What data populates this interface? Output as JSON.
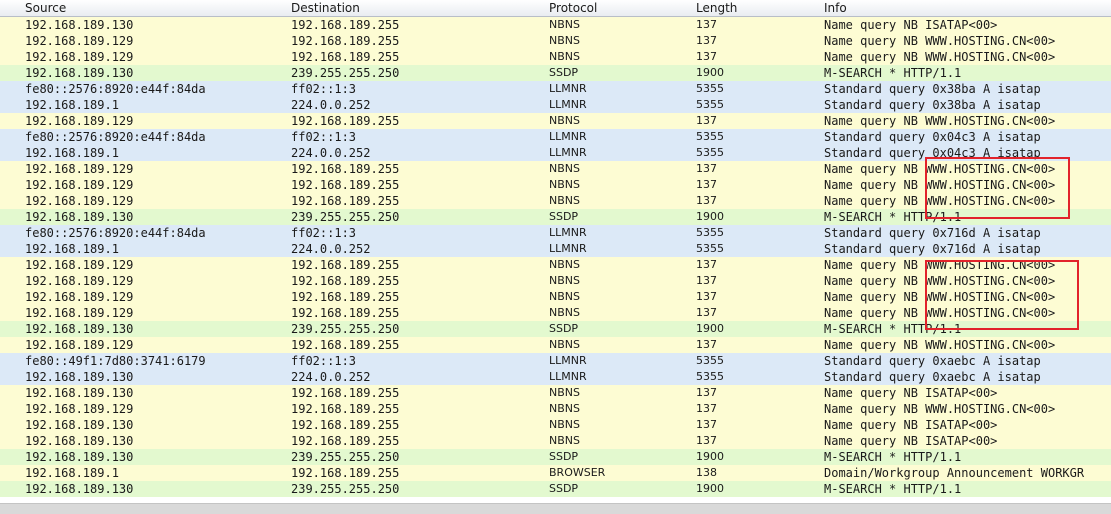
{
  "columns": {
    "source": "Source",
    "destination": "Destination",
    "protocol": "Protocol",
    "length": "Length",
    "info": "Info"
  },
  "colors": {
    "NBNS": "#fdfcd3",
    "SSDP": "#e3f9cf",
    "LLMNR": "#dce9f7",
    "BROWSER": "#fdfcd3",
    "highlight_box": "#e2232b"
  },
  "packets": [
    {
      "source": "192.168.189.130",
      "destination": "192.168.189.255",
      "protocol": "NBNS",
      "length": "137",
      "info": "Name query NB ISATAP<00>"
    },
    {
      "source": "192.168.189.129",
      "destination": "192.168.189.255",
      "protocol": "NBNS",
      "length": "137",
      "info": "Name query NB WWW.HOSTING.CN<00>"
    },
    {
      "source": "192.168.189.129",
      "destination": "192.168.189.255",
      "protocol": "NBNS",
      "length": "137",
      "info": "Name query NB WWW.HOSTING.CN<00>"
    },
    {
      "source": "192.168.189.130",
      "destination": "239.255.255.250",
      "protocol": "SSDP",
      "length": "1900",
      "info": "M-SEARCH * HTTP/1.1"
    },
    {
      "source": "fe80::2576:8920:e44f:84da",
      "destination": "ff02::1:3",
      "protocol": "LLMNR",
      "length": "5355",
      "info": "Standard query 0x38ba  A isatap"
    },
    {
      "source": "192.168.189.1",
      "destination": "224.0.0.252",
      "protocol": "LLMNR",
      "length": "5355",
      "info": "Standard query 0x38ba  A isatap"
    },
    {
      "source": "192.168.189.129",
      "destination": "192.168.189.255",
      "protocol": "NBNS",
      "length": "137",
      "info": "Name query NB WWW.HOSTING.CN<00>"
    },
    {
      "source": "fe80::2576:8920:e44f:84da",
      "destination": "ff02::1:3",
      "protocol": "LLMNR",
      "length": "5355",
      "info": "Standard query 0x04c3  A isatap"
    },
    {
      "source": "192.168.189.1",
      "destination": "224.0.0.252",
      "protocol": "LLMNR",
      "length": "5355",
      "info": "Standard query 0x04c3  A isatap"
    },
    {
      "source": "192.168.189.129",
      "destination": "192.168.189.255",
      "protocol": "NBNS",
      "length": "137",
      "info": "Name query NB WWW.HOSTING.CN<00>"
    },
    {
      "source": "192.168.189.129",
      "destination": "192.168.189.255",
      "protocol": "NBNS",
      "length": "137",
      "info": "Name query NB WWW.HOSTING.CN<00>"
    },
    {
      "source": "192.168.189.129",
      "destination": "192.168.189.255",
      "protocol": "NBNS",
      "length": "137",
      "info": "Name query NB WWW.HOSTING.CN<00>"
    },
    {
      "source": "192.168.189.130",
      "destination": "239.255.255.250",
      "protocol": "SSDP",
      "length": "1900",
      "info": "M-SEARCH * HTTP/1.1"
    },
    {
      "source": "fe80::2576:8920:e44f:84da",
      "destination": "ff02::1:3",
      "protocol": "LLMNR",
      "length": "5355",
      "info": "Standard query 0x716d  A isatap"
    },
    {
      "source": "192.168.189.1",
      "destination": "224.0.0.252",
      "protocol": "LLMNR",
      "length": "5355",
      "info": "Standard query 0x716d  A isatap"
    },
    {
      "source": "192.168.189.129",
      "destination": "192.168.189.255",
      "protocol": "NBNS",
      "length": "137",
      "info": "Name query NB WWW.HOSTING.CN<00>"
    },
    {
      "source": "192.168.189.129",
      "destination": "192.168.189.255",
      "protocol": "NBNS",
      "length": "137",
      "info": "Name query NB WWW.HOSTING.CN<00>"
    },
    {
      "source": "192.168.189.129",
      "destination": "192.168.189.255",
      "protocol": "NBNS",
      "length": "137",
      "info": "Name query NB WWW.HOSTING.CN<00>"
    },
    {
      "source": "192.168.189.129",
      "destination": "192.168.189.255",
      "protocol": "NBNS",
      "length": "137",
      "info": "Name query NB WWW.HOSTING.CN<00>"
    },
    {
      "source": "192.168.189.130",
      "destination": "239.255.255.250",
      "protocol": "SSDP",
      "length": "1900",
      "info": "M-SEARCH * HTTP/1.1"
    },
    {
      "source": "192.168.189.129",
      "destination": "192.168.189.255",
      "protocol": "NBNS",
      "length": "137",
      "info": "Name query NB WWW.HOSTING.CN<00>"
    },
    {
      "source": "fe80::49f1:7d80:3741:6179",
      "destination": "ff02::1:3",
      "protocol": "LLMNR",
      "length": "5355",
      "info": "Standard query 0xaebc  A isatap"
    },
    {
      "source": "192.168.189.130",
      "destination": "224.0.0.252",
      "protocol": "LLMNR",
      "length": "5355",
      "info": "Standard query 0xaebc  A isatap"
    },
    {
      "source": "192.168.189.130",
      "destination": "192.168.189.255",
      "protocol": "NBNS",
      "length": "137",
      "info": "Name query NB ISATAP<00>"
    },
    {
      "source": "192.168.189.129",
      "destination": "192.168.189.255",
      "protocol": "NBNS",
      "length": "137",
      "info": "Name query NB WWW.HOSTING.CN<00>"
    },
    {
      "source": "192.168.189.130",
      "destination": "192.168.189.255",
      "protocol": "NBNS",
      "length": "137",
      "info": "Name query NB ISATAP<00>"
    },
    {
      "source": "192.168.189.130",
      "destination": "192.168.189.255",
      "protocol": "NBNS",
      "length": "137",
      "info": "Name query NB ISATAP<00>"
    },
    {
      "source": "192.168.189.130",
      "destination": "239.255.255.250",
      "protocol": "SSDP",
      "length": "1900",
      "info": "M-SEARCH * HTTP/1.1"
    },
    {
      "source": "192.168.189.1",
      "destination": "192.168.189.255",
      "protocol": "BROWSER",
      "length": "138",
      "info": "Domain/Workgroup Announcement WORKGR"
    },
    {
      "source": "192.168.189.130",
      "destination": "239.255.255.250",
      "protocol": "SSDP",
      "length": "1900",
      "info": "M-SEARCH * HTTP/1.1"
    }
  ]
}
